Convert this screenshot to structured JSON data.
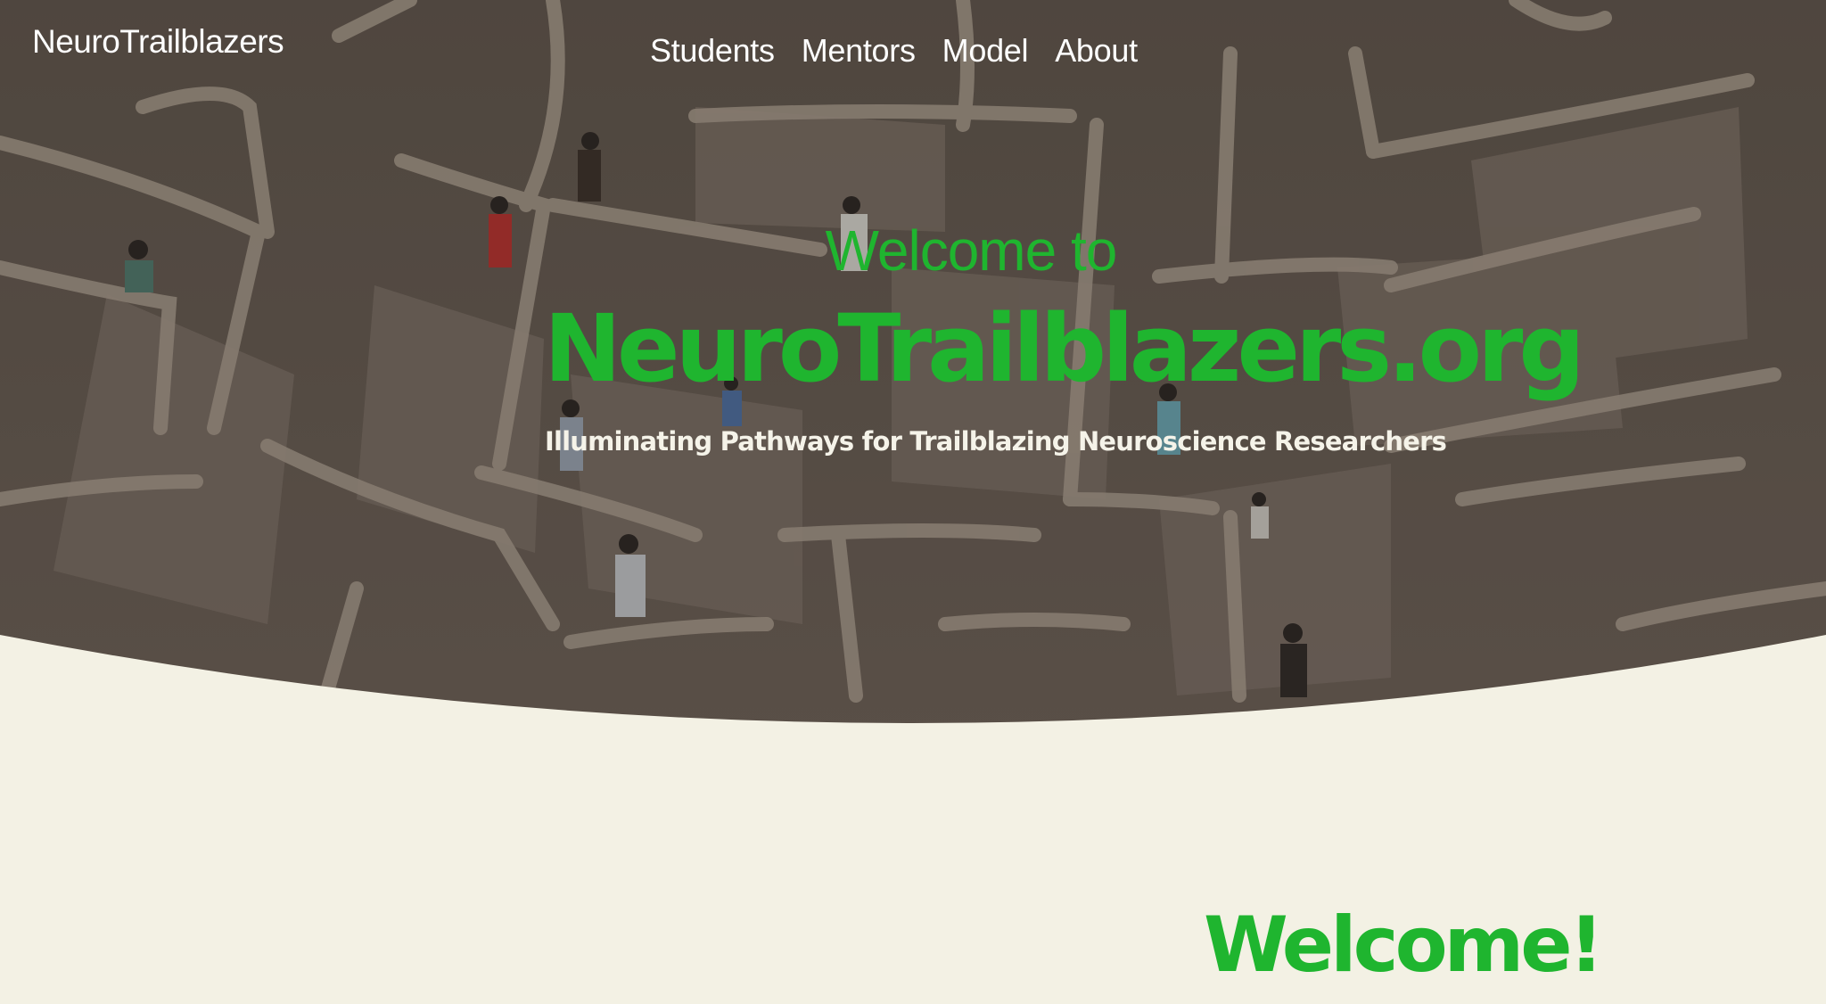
{
  "header": {
    "brand": "NeuroTrailblazers",
    "nav": [
      {
        "label": "Students"
      },
      {
        "label": "Mentors"
      },
      {
        "label": "Model"
      },
      {
        "label": "About"
      }
    ]
  },
  "hero": {
    "welcome_to": "Welcome to",
    "title": "NeuroTrailblazers.org",
    "tagline": "Illuminating Pathways for Trailblazing Neuroscience Researchers",
    "background_image": "maze-photo"
  },
  "section": {
    "heading": "Welcome!"
  },
  "colors": {
    "accent": "#1fb52f",
    "background": "#f3f1e4",
    "nav_text": "#ffffff"
  }
}
